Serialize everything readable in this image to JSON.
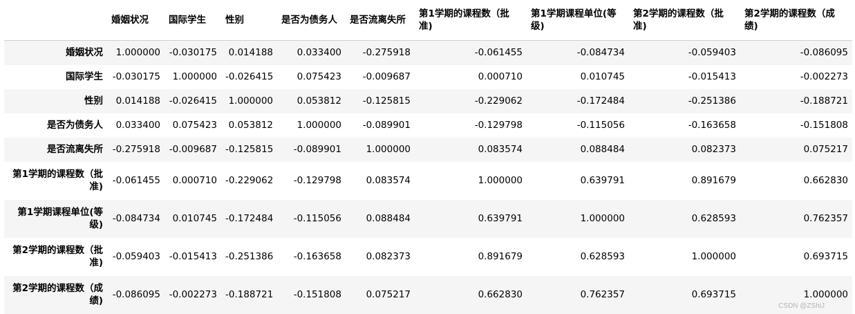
{
  "table": {
    "columns": [
      "婚姻状况",
      "国际学生",
      "性别",
      "是否为债务人",
      "是否流离失所",
      "第1学期的课程数（批准)",
      "第1学期课程单位(等级)",
      "第2学期的课程数（批准)",
      "第2学期的课程数（成绩)"
    ],
    "rows": [
      {
        "label": "婚姻状况",
        "values": [
          "1.000000",
          "-0.030175",
          "0.014188",
          "0.033400",
          "-0.275918",
          "-0.061455",
          "-0.084734",
          "-0.059403",
          "-0.086095"
        ]
      },
      {
        "label": "国际学生",
        "values": [
          "-0.030175",
          "1.000000",
          "-0.026415",
          "0.075423",
          "-0.009687",
          "0.000710",
          "0.010745",
          "-0.015413",
          "-0.002273"
        ]
      },
      {
        "label": "性别",
        "values": [
          "0.014188",
          "-0.026415",
          "1.000000",
          "0.053812",
          "-0.125815",
          "-0.229062",
          "-0.172484",
          "-0.251386",
          "-0.188721"
        ]
      },
      {
        "label": "是否为债务人",
        "values": [
          "0.033400",
          "0.075423",
          "0.053812",
          "1.000000",
          "-0.089901",
          "-0.129798",
          "-0.115056",
          "-0.163658",
          "-0.151808"
        ]
      },
      {
        "label": "是否流离失所",
        "values": [
          "-0.275918",
          "-0.009687",
          "-0.125815",
          "-0.089901",
          "1.000000",
          "0.083574",
          "0.088484",
          "0.082373",
          "0.075217"
        ]
      },
      {
        "label": "第1学期的课程数（批准)",
        "values": [
          "-0.061455",
          "0.000710",
          "-0.229062",
          "-0.129798",
          "0.083574",
          "1.000000",
          "0.639791",
          "0.891679",
          "0.662830"
        ]
      },
      {
        "label": "第1学期课程单位(等级)",
        "values": [
          "-0.084734",
          "0.010745",
          "-0.172484",
          "-0.115056",
          "0.088484",
          "0.639791",
          "1.000000",
          "0.628593",
          "0.762357"
        ]
      },
      {
        "label": "第2学期的课程数（批准)",
        "values": [
          "-0.059403",
          "-0.015413",
          "-0.251386",
          "-0.163658",
          "0.082373",
          "0.891679",
          "0.628593",
          "1.000000",
          "0.693715"
        ]
      },
      {
        "label": "第2学期的课程数（成绩)",
        "values": [
          "-0.086095",
          "-0.002273",
          "-0.188721",
          "-0.151808",
          "0.075217",
          "0.662830",
          "0.762357",
          "0.693715",
          "1.000000"
        ]
      }
    ]
  },
  "watermark": "CSDN @ZShiJ"
}
